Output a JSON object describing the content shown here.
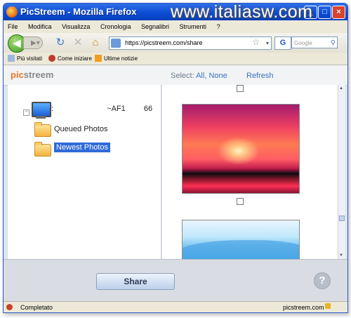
{
  "window": {
    "title": "PicStreem - Mozilla Firefox",
    "watermark": "www.italiasw.com"
  },
  "menu": [
    "File",
    "Modifica",
    "Visualizza",
    "Cronologia",
    "Segnalibri",
    "Strumenti",
    "?"
  ],
  "toolbar": {
    "url": "https://picstreem.com/share",
    "search_placeholder": "Google",
    "search_engine_glyph": "G"
  },
  "bookmarks": [
    {
      "label": "Più visitati",
      "icon": "bookmarks-icon"
    },
    {
      "label": "Come iniziare",
      "icon": "firefox-icon"
    },
    {
      "label": "Ultime notizie",
      "icon": "rss-icon"
    }
  ],
  "app": {
    "logo_a": "pic",
    "logo_b": "streem",
    "select_label": "Select:",
    "select_all": "All,",
    "select_none": "None",
    "refresh": "Refresh"
  },
  "tree": {
    "device_prefix": ":",
    "device_id": "~AF1",
    "device_suffix": "66",
    "folders": [
      {
        "label": "Queued Photos",
        "selected": false
      },
      {
        "label": "Newest Photos",
        "selected": true
      }
    ]
  },
  "footer": {
    "share_label": "Share",
    "help_label": "?"
  },
  "status": {
    "left": "Completato",
    "right": "picstreem.com"
  }
}
